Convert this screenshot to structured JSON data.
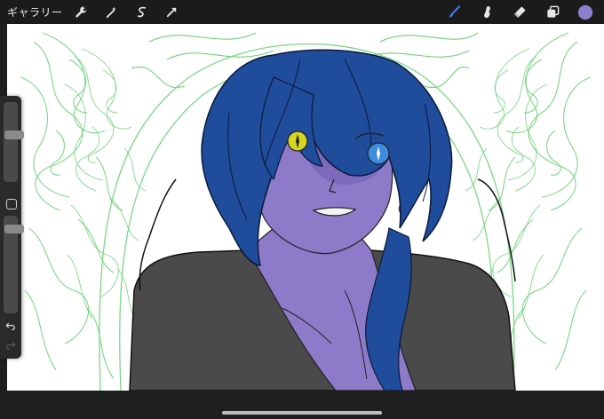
{
  "toolbar": {
    "gallery_label": "ギャラリー",
    "left_tools": [
      "wrench-icon",
      "magic-wand-icon",
      "selection-icon",
      "transform-arrow-icon"
    ],
    "right_tools": [
      "brush-icon",
      "smudge-icon",
      "eraser-icon",
      "layers-icon"
    ],
    "active_tool": "brush",
    "active_color": "#8f80cf",
    "brush_icon_color": "#3f7fe8"
  },
  "sidebar": {
    "brush_size_level": 0.6,
    "brush_opacity_level": 0.1,
    "icons": [
      "modify-square-icon",
      "undo-icon",
      "redo-icon"
    ]
  },
  "canvas": {
    "background": "#ffffff",
    "sketch_line_color": "#6fd27a",
    "hair_color": "#1f4c9b",
    "skin_color": "#8d7ac9",
    "clothing_color": "#4a4a4a",
    "left_eye_color": "#d6d622",
    "right_eye_color": "#3c8de0"
  }
}
